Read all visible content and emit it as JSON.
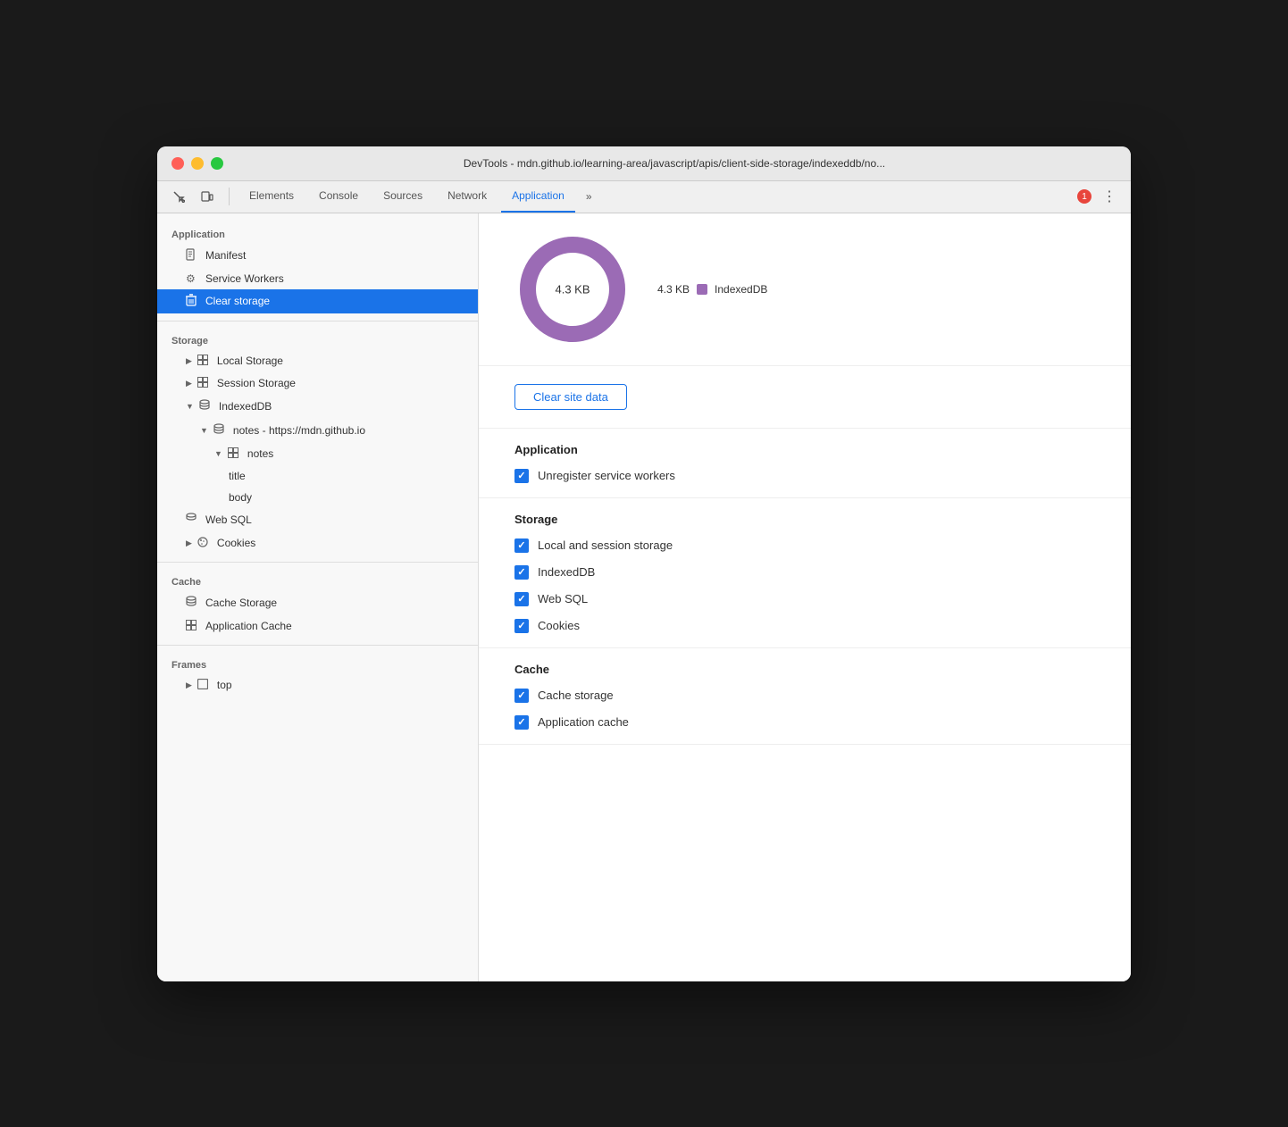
{
  "titleBar": {
    "title": "DevTools - mdn.github.io/learning-area/javascript/apis/client-side-storage/indexeddb/no..."
  },
  "toolbar": {
    "tabs": [
      {
        "label": "Elements",
        "active": false
      },
      {
        "label": "Console",
        "active": false
      },
      {
        "label": "Sources",
        "active": false
      },
      {
        "label": "Network",
        "active": false
      },
      {
        "label": "Application",
        "active": true
      }
    ],
    "more_label": "»",
    "error_count": "1",
    "menu_icon": "⋮"
  },
  "sidebar": {
    "sections": [
      {
        "header": "Application",
        "items": [
          {
            "label": "Manifest",
            "icon": "📄",
            "indent": 1,
            "active": false
          },
          {
            "label": "Service Workers",
            "icon": "⚙",
            "indent": 1,
            "active": false
          },
          {
            "label": "Clear storage",
            "icon": "🗑",
            "indent": 1,
            "active": true
          }
        ]
      },
      {
        "header": "Storage",
        "items": [
          {
            "label": "Local Storage",
            "icon": "▶",
            "indent": 1,
            "active": false,
            "has_chevron": true
          },
          {
            "label": "Session Storage",
            "icon": "▶",
            "indent": 1,
            "active": false,
            "has_chevron": true
          },
          {
            "label": "IndexedDB",
            "icon": "▼",
            "indent": 1,
            "active": false,
            "has_chevron": true
          },
          {
            "label": "notes - https://mdn.github.io",
            "icon": "▼",
            "indent": 2,
            "active": false,
            "has_chevron": true
          },
          {
            "label": "notes",
            "icon": "▼",
            "indent": 3,
            "active": false,
            "has_chevron": true
          },
          {
            "label": "title",
            "icon": "",
            "indent": 4,
            "active": false
          },
          {
            "label": "body",
            "icon": "",
            "indent": 4,
            "active": false
          },
          {
            "label": "Web SQL",
            "icon": "🗄",
            "indent": 1,
            "active": false
          },
          {
            "label": "Cookies",
            "icon": "▶",
            "indent": 1,
            "active": false,
            "has_chevron": true
          }
        ]
      },
      {
        "header": "Cache",
        "items": [
          {
            "label": "Cache Storage",
            "icon": "🗄",
            "indent": 1,
            "active": false
          },
          {
            "label": "Application Cache",
            "icon": "⊞",
            "indent": 1,
            "active": false
          }
        ]
      },
      {
        "header": "Frames",
        "items": [
          {
            "label": "top",
            "icon": "▶",
            "indent": 1,
            "active": false,
            "has_chevron": true
          }
        ]
      }
    ]
  },
  "panel": {
    "chart": {
      "value": "4.3 KB",
      "center_label": "4.3 KB",
      "legend": [
        {
          "color": "#9b6bb5",
          "value": "4.3 KB",
          "label": "IndexedDB"
        }
      ]
    },
    "clear_button_label": "Clear site data",
    "sections": [
      {
        "title": "Application",
        "items": [
          {
            "label": "Unregister service workers",
            "checked": true
          }
        ]
      },
      {
        "title": "Storage",
        "items": [
          {
            "label": "Local and session storage",
            "checked": true
          },
          {
            "label": "IndexedDB",
            "checked": true
          },
          {
            "label": "Web SQL",
            "checked": true
          },
          {
            "label": "Cookies",
            "checked": true
          }
        ]
      },
      {
        "title": "Cache",
        "items": [
          {
            "label": "Cache storage",
            "checked": true
          },
          {
            "label": "Application cache",
            "checked": true
          }
        ]
      }
    ]
  }
}
